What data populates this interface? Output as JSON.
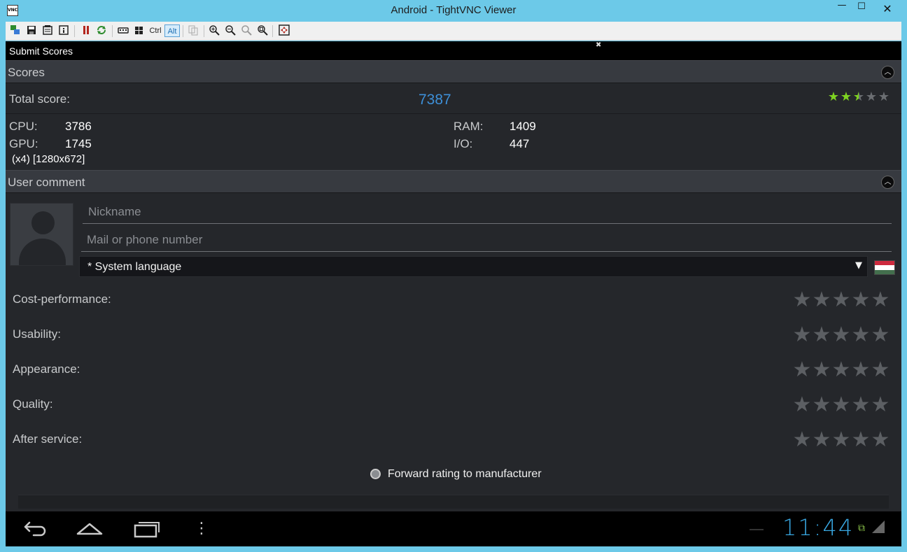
{
  "window": {
    "title": "Android - TightVNC Viewer",
    "app_icon_text": "VNC",
    "min_glyph": "—",
    "max_glyph": "☐",
    "close_glyph": "✕"
  },
  "toolbar": {
    "ctrl_label": "Ctrl",
    "alt_label": "Alt"
  },
  "screen": {
    "action_title": "Submit Scores",
    "scores": {
      "header": "Scores",
      "total_label": "Total score:",
      "total_value": "7387",
      "rating": 2.5,
      "rating_max": 5,
      "cpu_label": "CPU:",
      "cpu_value": "3786",
      "gpu_label": "GPU:",
      "gpu_value": "1745",
      "ram_label": "RAM:",
      "ram_value": "1409",
      "io_label": "I/O:",
      "io_value": "447",
      "resolution": "(x4) [1280x672]"
    },
    "comment": {
      "header": "User comment",
      "nickname_placeholder": "Nickname",
      "mail_placeholder": "Mail or phone number",
      "language_value": "* System language",
      "ratings": [
        {
          "label": "Cost-performance:"
        },
        {
          "label": "Usability:"
        },
        {
          "label": "Appearance:"
        },
        {
          "label": "Quality:"
        },
        {
          "label": "After service:"
        }
      ],
      "forward_label": "Forward rating to manufacturer"
    },
    "navbar": {
      "clock": "11:44"
    }
  },
  "colors": {
    "accent_blue": "#3d8fd8",
    "star_green": "#7ed321",
    "flag_red": "#cd2a3e",
    "flag_white": "#ffffff",
    "flag_green": "#436f4d"
  }
}
